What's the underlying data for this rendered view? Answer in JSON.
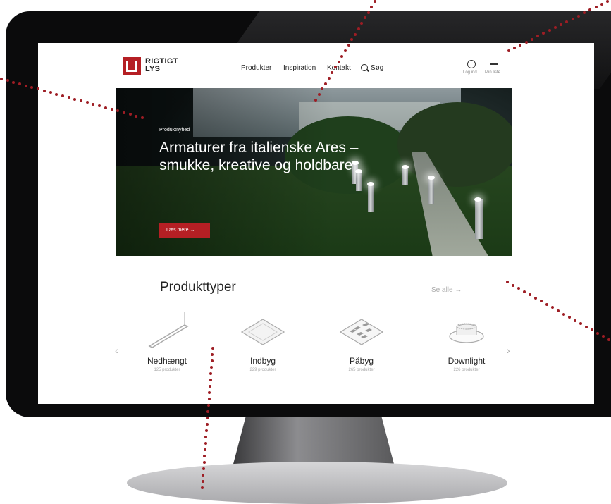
{
  "brand": {
    "logo_text_line1": "RIGTIGT",
    "logo_text_line2": "LYS",
    "accent": "#b51f24"
  },
  "nav": {
    "items": [
      "Produkter",
      "Inspiration",
      "Kontakt"
    ],
    "search_label": "Søg"
  },
  "header_actions": {
    "login_label": "Log ind",
    "list_label": "Min liste"
  },
  "hero": {
    "kicker": "Produktnyhed",
    "title": "Armaturer fra italienske Ares – smukke, kreative og holdbare",
    "button_label": "Læs mere →"
  },
  "products": {
    "title": "Produkttyper",
    "see_all": "Se alle →",
    "items": [
      {
        "name": "Nedhængt",
        "count": "125 produkter",
        "icon": "pendant-light-icon"
      },
      {
        "name": "Indbyg",
        "count": "229 produkter",
        "icon": "recessed-panel-icon"
      },
      {
        "name": "Påbyg",
        "count": "265 produkter",
        "icon": "surface-panel-icon"
      },
      {
        "name": "Downlight",
        "count": "226 produkter",
        "icon": "downlight-icon"
      }
    ]
  },
  "carousel": {
    "prev_icon": "chevron-left-icon",
    "next_icon": "chevron-right-icon"
  }
}
